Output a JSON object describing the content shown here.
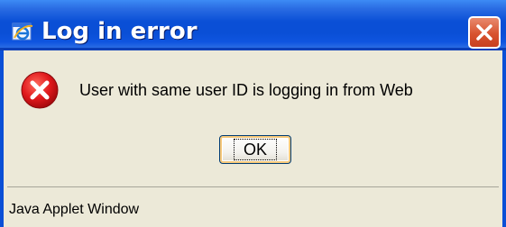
{
  "window": {
    "title": "Log in error",
    "app_icon": "internet-explorer-icon",
    "close_icon": "close-icon"
  },
  "dialog": {
    "icon": "error-icon",
    "message": "User with same user ID is logging in from Web",
    "ok_label": "OK"
  },
  "status_bar": {
    "text": "Java Applet Window"
  },
  "colors": {
    "titlebar": "#0a4fd6",
    "close_button": "#d8532f",
    "dialog_background": "#ece9d8",
    "error_red": "#e0191c"
  }
}
